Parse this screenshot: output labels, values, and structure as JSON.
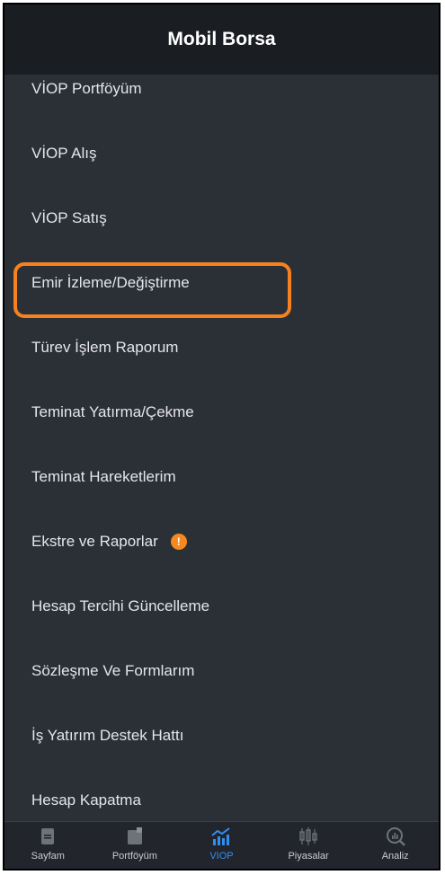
{
  "header": {
    "title": "Mobil Borsa"
  },
  "menu": {
    "items": [
      {
        "label": "VİOP Portföyüm"
      },
      {
        "label": "VİOP Alış"
      },
      {
        "label": "VİOP Satış"
      },
      {
        "label": "Emir İzleme/Değiştirme"
      },
      {
        "label": "Türev İşlem Raporum"
      },
      {
        "label": "Teminat Yatırma/Çekme"
      },
      {
        "label": "Teminat Hareketlerim"
      },
      {
        "label": "Ekstre ve Raporlar",
        "badge": "!"
      },
      {
        "label": "Hesap Tercihi Güncelleme"
      },
      {
        "label": "Sözleşme Ve Formlarım"
      },
      {
        "label": "İş Yatırım Destek Hattı"
      },
      {
        "label": "Hesap Kapatma"
      }
    ],
    "highlighted_item": "Emir İzleme/Değiştirme"
  },
  "tabbar": {
    "tabs": [
      {
        "label": "Sayfam",
        "icon": "page-icon",
        "active": false
      },
      {
        "label": "Portföyüm",
        "icon": "portfolio-icon",
        "active": false
      },
      {
        "label": "VIOP",
        "icon": "viop-chart-icon",
        "active": true
      },
      {
        "label": "Piyasalar",
        "icon": "candlestick-icon",
        "active": false
      },
      {
        "label": "Analiz",
        "icon": "analysis-magnifier-icon",
        "active": false
      }
    ]
  },
  "colors": {
    "background": "#2b2f36",
    "header_background": "#1a1d22",
    "highlight_border": "#f5821f",
    "badge": "#f5891f",
    "active_tab": "#2f8ef0",
    "inactive_tab_icon": "#6d727b"
  }
}
